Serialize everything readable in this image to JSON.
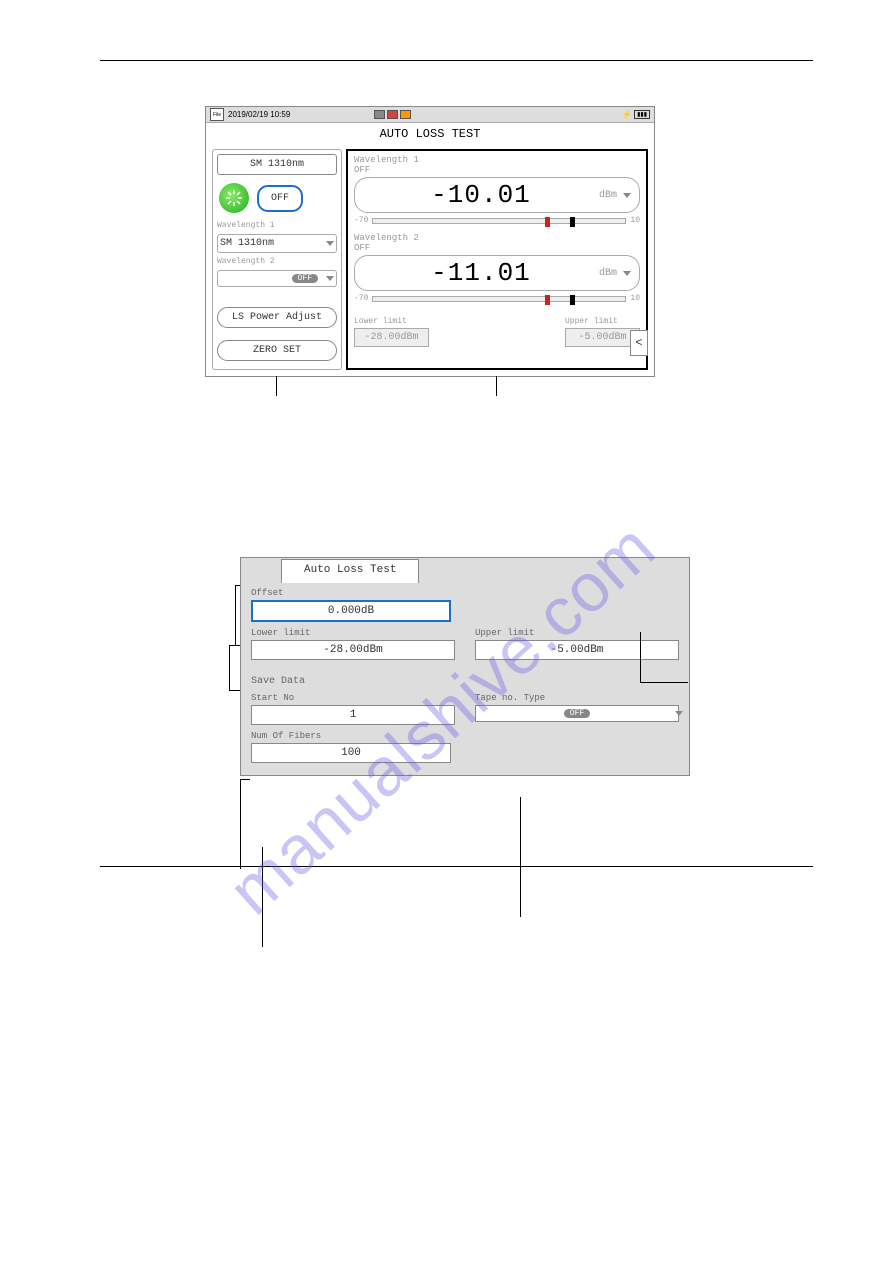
{
  "statusbar": {
    "file_icon_label": "File",
    "datetime": "2019/02/19 10:59",
    "plug_icon": "⚡",
    "battery_icon": "▮▮▮"
  },
  "screen": {
    "title": "AUTO LOSS TEST"
  },
  "left_panel": {
    "sm_label": "SM 1310nm",
    "laser_state": "OFF",
    "wl1_label": "Wavelength 1",
    "wl1_value": "SM 1310nm",
    "wl2_label": "Wavelength 2",
    "wl2_value": "OFF",
    "ls_power_adjust": "LS Power Adjust",
    "zero_set": "ZERO SET"
  },
  "right_panel": {
    "wl1_label": "Wavelength 1",
    "wl1_state": "OFF",
    "wl1_reading": "-10.01",
    "wl1_unit": "dBm",
    "scale_min": "-70",
    "scale_max": "10",
    "wl2_label": "Wavelength 2",
    "wl2_state": "OFF",
    "wl2_reading": "-11.01",
    "wl2_unit": "dBm",
    "lower_limit_label": "Lower limit",
    "lower_limit_value": "-28.00dBm",
    "upper_limit_label": "Upper limit",
    "upper_limit_value": "-5.00dBm",
    "arrow": "<"
  },
  "setup": {
    "tab_label": "Auto Loss Test",
    "offset_label": "Offset",
    "offset_value": "0.000dB",
    "lower_label": "Lower limit",
    "lower_value": "-28.00dBm",
    "upper_label": "Upper limit",
    "upper_value": "-5.00dBm",
    "save_section": "Save Data",
    "startno_label": "Start No",
    "startno_value": "1",
    "tapeno_label": "Tape no. Type",
    "tapeno_value": "OFF",
    "numfibers_label": "Num Of Fibers",
    "numfibers_value": "100"
  },
  "watermark": "manualshive.com"
}
